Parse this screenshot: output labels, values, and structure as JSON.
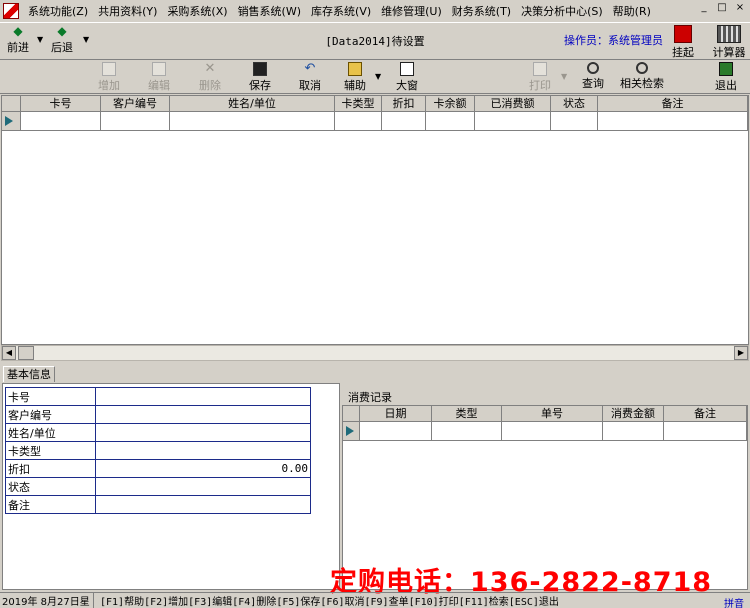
{
  "menu": [
    "系统功能(Z)",
    "共用资料(Y)",
    "采购系统(X)",
    "销售系统(W)",
    "库存系统(V)",
    "维修管理(U)",
    "财务系统(T)",
    "决策分析中心(S)",
    "帮助(R)"
  ],
  "window_controls": [
    "_",
    "□",
    "×"
  ],
  "nav": {
    "forward": "前进",
    "back": "后退"
  },
  "db_title": "[Data2014]待设置",
  "operator": "操作员：系统管理员",
  "top_right": {
    "hold": "挂起",
    "calc": "计算器"
  },
  "toolbar": {
    "add": "增加",
    "edit": "编辑",
    "delete": "删除",
    "save": "保存",
    "cancel": "取消",
    "assist": "辅助",
    "big_window": "大窗",
    "print": "打印",
    "query": "查询",
    "related_search": "相关检索",
    "exit": "退出"
  },
  "main_grid": {
    "columns": [
      "卡号",
      "客户编号",
      "姓名/单位",
      "卡类型",
      "折扣",
      "卡余额",
      "已消费额",
      "状态",
      "备注"
    ]
  },
  "basic_tab": "基本信息",
  "basic_form": [
    {
      "label": "卡号",
      "value": ""
    },
    {
      "label": "客户编号",
      "value": ""
    },
    {
      "label": "姓名/单位",
      "value": ""
    },
    {
      "label": "卡类型",
      "value": ""
    },
    {
      "label": "折扣",
      "value": "0.00"
    },
    {
      "label": "状态",
      "value": ""
    },
    {
      "label": "备注",
      "value": ""
    }
  ],
  "consume": {
    "title": "消费记录",
    "columns": [
      "日期",
      "类型",
      "单号",
      "消费金额",
      "备注"
    ]
  },
  "watermark": "定购电话：136-2822-8718",
  "statusbar": {
    "date": "2019年 8月27日星",
    "keys": "[F1]帮助[F2]增加[F3]编辑[F4]删除[F5]保存[F6]取消[F9]查单[F10]打印[F11]检索[ESC]退出",
    "ime": "拼音"
  }
}
